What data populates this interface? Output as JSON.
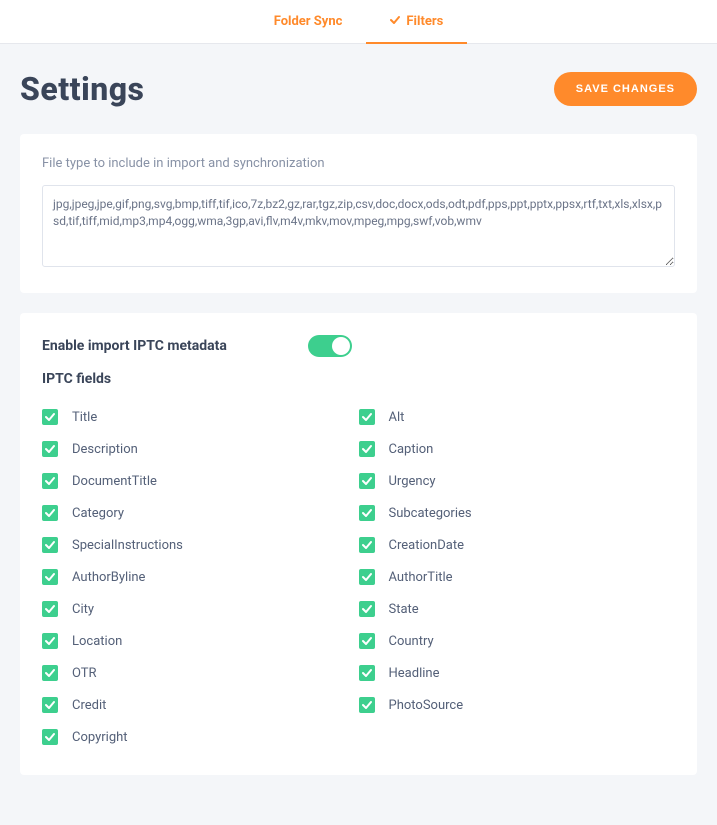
{
  "tabs": {
    "0": {
      "label": "Folder Sync"
    },
    "1": {
      "label": "Filters"
    }
  },
  "header": {
    "title": "Settings",
    "saveLabel": "SAVE CHANGES"
  },
  "fileTypes": {
    "label": "File type to include in import and synchronization",
    "value": "jpg,jpeg,jpe,gif,png,svg,bmp,tiff,tif,ico,7z,bz2,gz,rar,tgz,zip,csv,doc,docx,ods,odt,pdf,pps,ppt,pptx,ppsx,rtf,txt,xls,xlsx,psd,tif,tiff,mid,mp3,mp4,ogg,wma,3gp,avi,flv,m4v,mkv,mov,mpeg,mpg,swf,vob,wmv"
  },
  "iptc": {
    "enableLabel": "Enable import IPTC metadata",
    "enabled": true,
    "fieldsHeader": "IPTC fields",
    "left": {
      "0": {
        "label": "Title"
      },
      "1": {
        "label": "Description"
      },
      "2": {
        "label": "DocumentTitle"
      },
      "3": {
        "label": "Category"
      },
      "4": {
        "label": "SpecialInstructions"
      },
      "5": {
        "label": "AuthorByline"
      },
      "6": {
        "label": "City"
      },
      "7": {
        "label": "Location"
      },
      "8": {
        "label": "OTR"
      },
      "9": {
        "label": "Credit"
      },
      "10": {
        "label": "Copyright"
      }
    },
    "right": {
      "0": {
        "label": "Alt"
      },
      "1": {
        "label": "Caption"
      },
      "2": {
        "label": "Urgency"
      },
      "3": {
        "label": "Subcategories"
      },
      "4": {
        "label": "CreationDate"
      },
      "5": {
        "label": "AuthorTitle"
      },
      "6": {
        "label": "State"
      },
      "7": {
        "label": "Country"
      },
      "8": {
        "label": "Headline"
      },
      "9": {
        "label": "PhotoSource"
      }
    }
  }
}
